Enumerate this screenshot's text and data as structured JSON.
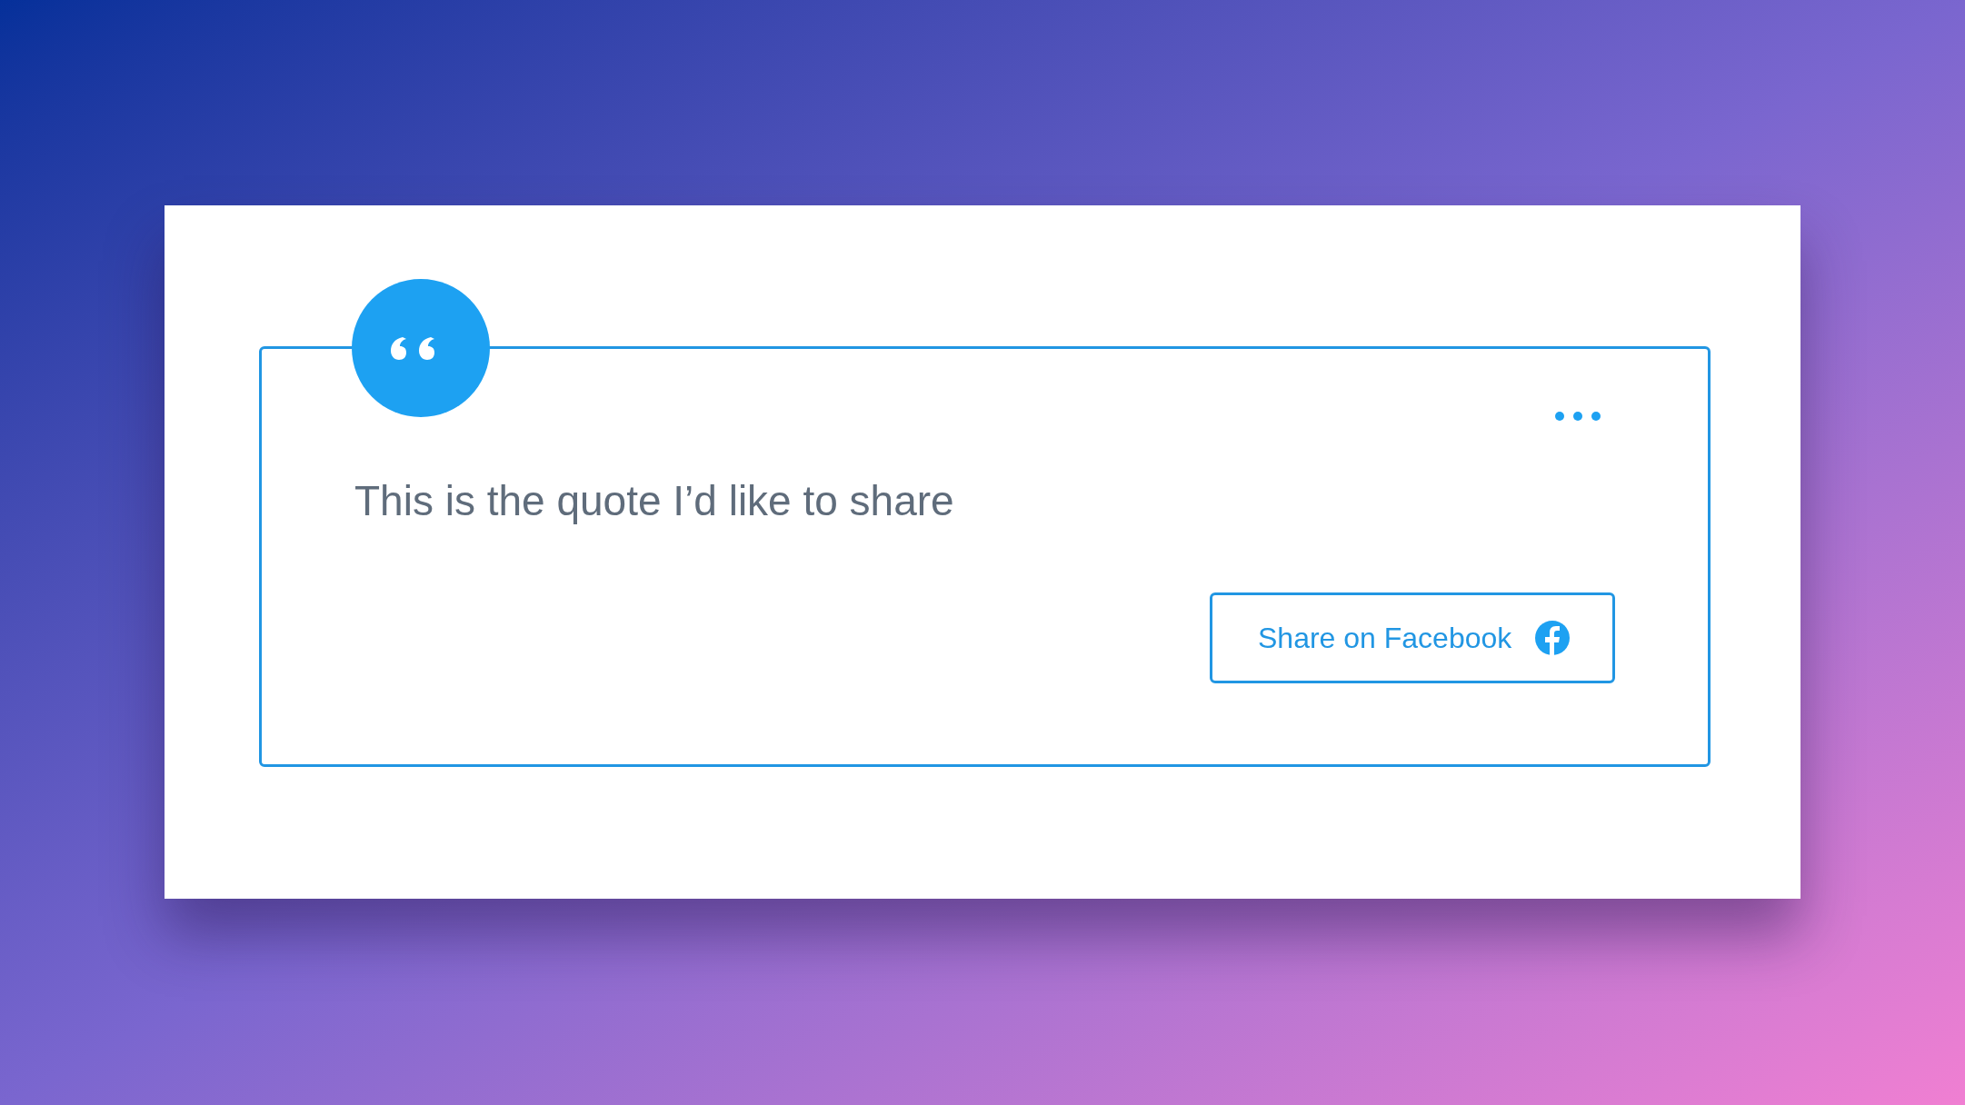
{
  "quote": {
    "text": "This is the quote I’d like to share"
  },
  "share_button": {
    "label": "Share on Facebook"
  }
}
